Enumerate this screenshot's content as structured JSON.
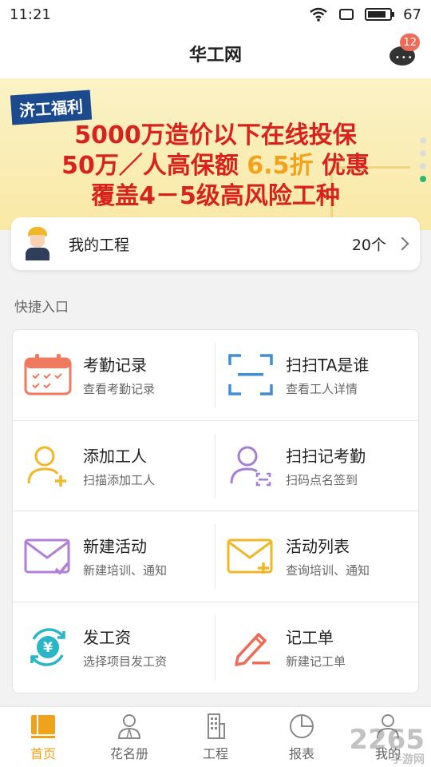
{
  "status": {
    "time": "11:21",
    "battery": "67"
  },
  "header": {
    "title": "华工网",
    "badge": "12"
  },
  "banner": {
    "tag": "济工福利",
    "line1": "5000万造价以下在线投保",
    "line2_a": "50万／人高保额",
    "line2_b": "6.5折",
    "line2_c": "优惠",
    "line3": "覆盖4－5级高风险工种"
  },
  "project": {
    "label": "我的工程",
    "count": "20个"
  },
  "quick": {
    "title": "快捷入口",
    "items": [
      {
        "title": "考勤记录",
        "subtitle": "查看考勤记录",
        "icon": "calendar-icon"
      },
      {
        "title": "扫扫TA是谁",
        "subtitle": "查看工人详情",
        "icon": "scan-frame-icon"
      },
      {
        "title": "添加工人",
        "subtitle": "扫描添加工人",
        "icon": "add-user-icon"
      },
      {
        "title": "扫扫记考勤",
        "subtitle": "扫码点名签到",
        "icon": "user-scan-icon"
      },
      {
        "title": "新建活动",
        "subtitle": "新建培训、通知",
        "icon": "mail-check-icon"
      },
      {
        "title": "活动列表",
        "subtitle": "查询培训、通知",
        "icon": "mail-add-icon"
      },
      {
        "title": "发工资",
        "subtitle": "选择项目发工资",
        "icon": "yuan-cycle-icon"
      },
      {
        "title": "记工单",
        "subtitle": "新建记工单",
        "icon": "pencil-icon"
      }
    ]
  },
  "tabs": [
    {
      "label": "首页",
      "icon": "home-icon"
    },
    {
      "label": "花名册",
      "icon": "roster-icon"
    },
    {
      "label": "工程",
      "icon": "building-icon"
    },
    {
      "label": "报表",
      "icon": "pie-chart-icon"
    },
    {
      "label": "我的",
      "icon": "profile-icon"
    }
  ],
  "watermark": {
    "main": "2265",
    "sub": "手游网"
  },
  "colors": {
    "accent": "#f0a21a",
    "badge": "#ef6b57",
    "bannerRed": "#d8221c"
  }
}
